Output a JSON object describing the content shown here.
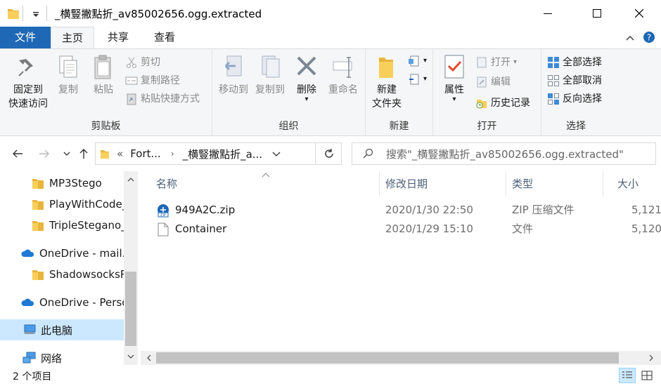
{
  "window": {
    "title": "_横豎撇點折_av85002656.ogg.extracted",
    "minimize_label": "—",
    "maximize_label": "☐",
    "close_label": "✕"
  },
  "ribbon_tabs": [
    "文件",
    "主页",
    "共享",
    "查看"
  ],
  "ribbon": {
    "clipboard": {
      "label": "剪贴板",
      "pin_line1": "固定到",
      "pin_line2": "快速访问",
      "copy": "复制",
      "paste": "粘贴",
      "cut": "剪切",
      "copy_path": "复制路径",
      "paste_shortcut": "粘贴快捷方式"
    },
    "organize": {
      "label": "组织",
      "move_to": "移动到",
      "copy_to": "复制到",
      "delete": "删除",
      "rename": "重命名"
    },
    "new": {
      "label": "新建",
      "new_folder_line1": "新建",
      "new_folder_line2": "文件夹"
    },
    "open": {
      "label": "打开",
      "properties": "属性",
      "open": "打开",
      "edit": "编辑",
      "history": "历史记录"
    },
    "select": {
      "label": "选择",
      "select_all": "全部选择",
      "select_none": "全部取消",
      "invert": "反向选择"
    }
  },
  "address": {
    "prefix": "«",
    "crumb1": "Fort...",
    "crumb2": "_横豎撇點折_a...",
    "search_placeholder": "搜索\"_横豎撇點折_av85002656.ogg.extracted\""
  },
  "nav_pane": {
    "items": [
      {
        "label": "MP3Stego",
        "icon": "folder-icon"
      },
      {
        "label": "PlayWithCode_",
        "icon": "folder-icon"
      },
      {
        "label": "TripleStegano_",
        "icon": "folder-icon"
      },
      {
        "label": "OneDrive - mail.l",
        "icon": "onedrive-cloud-icon"
      },
      {
        "label": "ShadowsocksR",
        "icon": "folder-icon"
      },
      {
        "label": "OneDrive - Perso",
        "icon": "onedrive-cloud-icon"
      },
      {
        "label": "此电脑",
        "icon": "computer-icon"
      },
      {
        "label": "网络",
        "icon": "network-icon"
      }
    ]
  },
  "file_list": {
    "columns": [
      "名称",
      "修改日期",
      "类型",
      "大小"
    ],
    "rows": [
      {
        "name": "949A2C.zip",
        "date": "2020/1/30 22:50",
        "type": "ZIP 压缩文件",
        "size": "5,121",
        "icon": "zip-file-icon"
      },
      {
        "name": "Container",
        "date": "2020/1/29 15:10",
        "type": "文件",
        "size": "5,120",
        "icon": "blank-file-icon"
      }
    ]
  },
  "status": {
    "item_count": "2 个项目"
  },
  "colors": {
    "file_tab": "#1e68b5",
    "selection": "#cce8ff",
    "ribbon_bg": "#f5f6f7"
  }
}
